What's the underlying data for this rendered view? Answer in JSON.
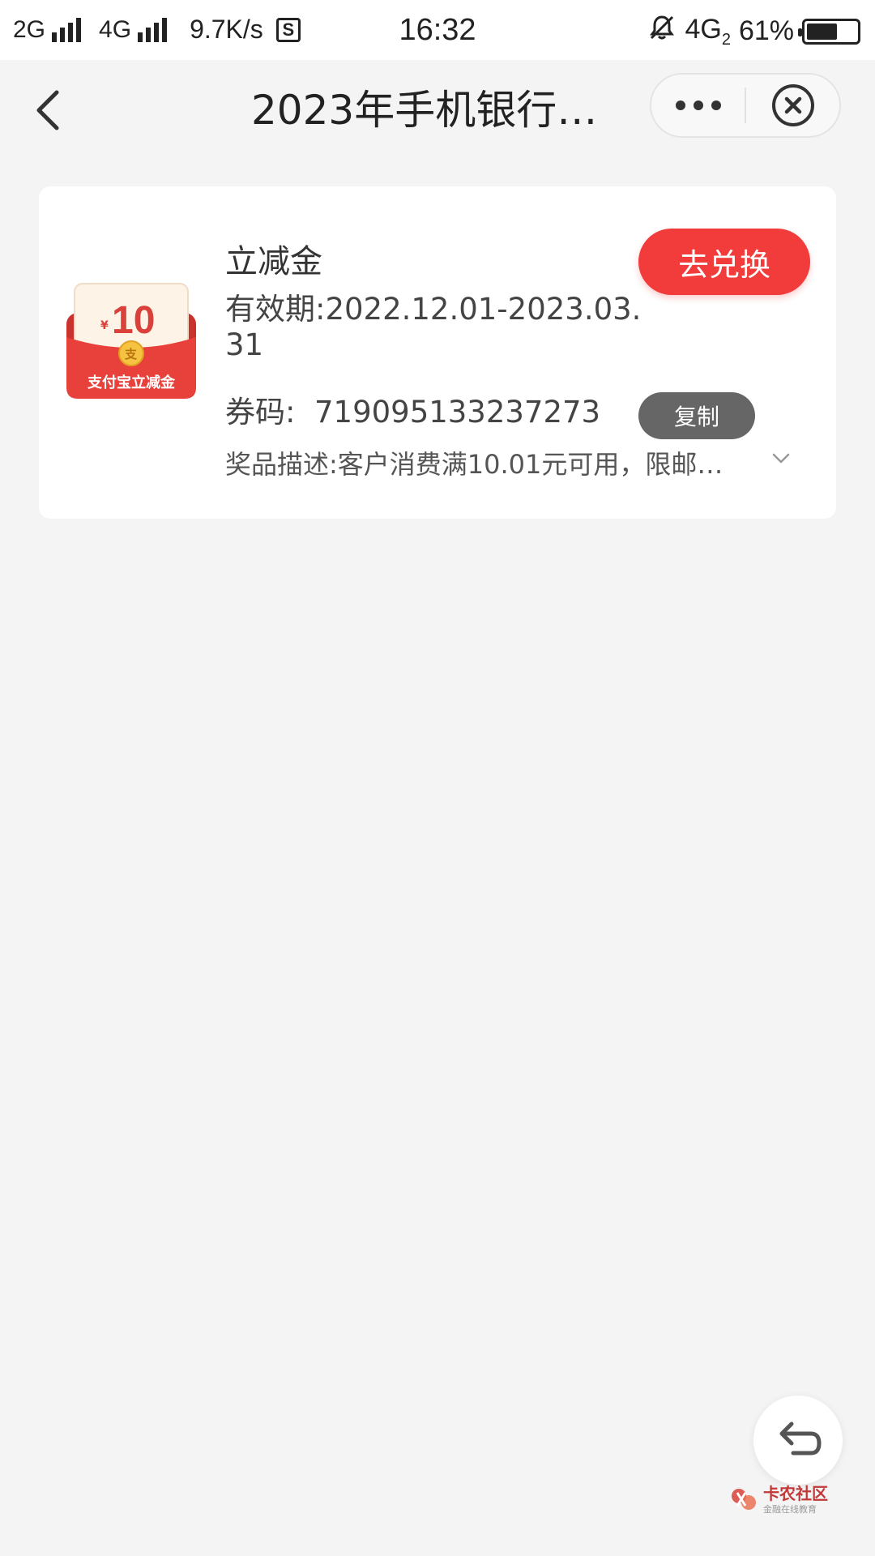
{
  "status_bar": {
    "net1": "2G",
    "net2": "4G",
    "speed": "9.7K/s",
    "s_icon": "S",
    "time": "16:32",
    "net3": "4G",
    "net3_sub": "2",
    "battery": "61%",
    "battery_level": 0.61,
    "icons": [
      "signal-icon",
      "signal-icon",
      "s-app-icon",
      "bell-off-icon",
      "battery-icon"
    ]
  },
  "nav": {
    "title": "2023年手机银行…",
    "back_icon": "chevron-left-icon",
    "more_icon": "more-dots-icon",
    "close_icon": "close-circle-icon"
  },
  "coupon": {
    "image": {
      "amount": "10",
      "currency": "¥",
      "label": "支付宝立减金",
      "coin_glyph": "支",
      "colors": {
        "red": "#e8403a",
        "card": "#fdf3e7",
        "coin": "#f5c242"
      }
    },
    "title": "立减金",
    "validity": "有效期:2022.12.01-2023.03.31",
    "code": "券码:  719095133237273",
    "description": "奖品描述:客户消费满10.01元可用，限邮…",
    "exchange_label": "去兑换",
    "copy_label": "复制",
    "expand_icon": "chevron-down-icon"
  },
  "float_back_icon": "return-arrow-icon",
  "watermark": {
    "main": "卡农社区",
    "sub": "金融在线教育"
  },
  "colors": {
    "accent_red": "#f23b3b",
    "copy_gray": "#666666",
    "background": "#f4f4f4"
  }
}
